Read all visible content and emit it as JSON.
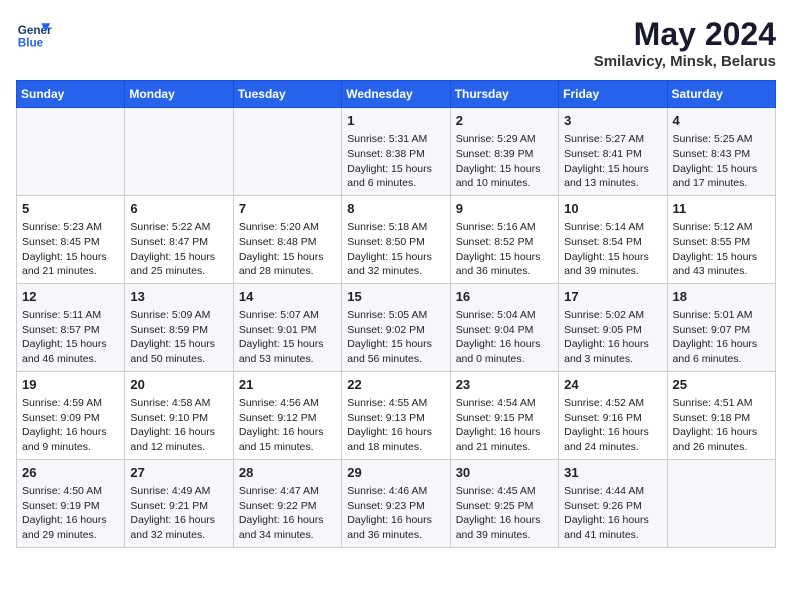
{
  "header": {
    "logo_line1": "General",
    "logo_line2": "Blue",
    "month": "May 2024",
    "location": "Smilavicy, Minsk, Belarus"
  },
  "days_of_week": [
    "Sunday",
    "Monday",
    "Tuesday",
    "Wednesday",
    "Thursday",
    "Friday",
    "Saturday"
  ],
  "weeks": [
    [
      {
        "day": "",
        "info": ""
      },
      {
        "day": "",
        "info": ""
      },
      {
        "day": "",
        "info": ""
      },
      {
        "day": "1",
        "info": "Sunrise: 5:31 AM\nSunset: 8:38 PM\nDaylight: 15 hours\nand 6 minutes."
      },
      {
        "day": "2",
        "info": "Sunrise: 5:29 AM\nSunset: 8:39 PM\nDaylight: 15 hours\nand 10 minutes."
      },
      {
        "day": "3",
        "info": "Sunrise: 5:27 AM\nSunset: 8:41 PM\nDaylight: 15 hours\nand 13 minutes."
      },
      {
        "day": "4",
        "info": "Sunrise: 5:25 AM\nSunset: 8:43 PM\nDaylight: 15 hours\nand 17 minutes."
      }
    ],
    [
      {
        "day": "5",
        "info": "Sunrise: 5:23 AM\nSunset: 8:45 PM\nDaylight: 15 hours\nand 21 minutes."
      },
      {
        "day": "6",
        "info": "Sunrise: 5:22 AM\nSunset: 8:47 PM\nDaylight: 15 hours\nand 25 minutes."
      },
      {
        "day": "7",
        "info": "Sunrise: 5:20 AM\nSunset: 8:48 PM\nDaylight: 15 hours\nand 28 minutes."
      },
      {
        "day": "8",
        "info": "Sunrise: 5:18 AM\nSunset: 8:50 PM\nDaylight: 15 hours\nand 32 minutes."
      },
      {
        "day": "9",
        "info": "Sunrise: 5:16 AM\nSunset: 8:52 PM\nDaylight: 15 hours\nand 36 minutes."
      },
      {
        "day": "10",
        "info": "Sunrise: 5:14 AM\nSunset: 8:54 PM\nDaylight: 15 hours\nand 39 minutes."
      },
      {
        "day": "11",
        "info": "Sunrise: 5:12 AM\nSunset: 8:55 PM\nDaylight: 15 hours\nand 43 minutes."
      }
    ],
    [
      {
        "day": "12",
        "info": "Sunrise: 5:11 AM\nSunset: 8:57 PM\nDaylight: 15 hours\nand 46 minutes."
      },
      {
        "day": "13",
        "info": "Sunrise: 5:09 AM\nSunset: 8:59 PM\nDaylight: 15 hours\nand 50 minutes."
      },
      {
        "day": "14",
        "info": "Sunrise: 5:07 AM\nSunset: 9:01 PM\nDaylight: 15 hours\nand 53 minutes."
      },
      {
        "day": "15",
        "info": "Sunrise: 5:05 AM\nSunset: 9:02 PM\nDaylight: 15 hours\nand 56 minutes."
      },
      {
        "day": "16",
        "info": "Sunrise: 5:04 AM\nSunset: 9:04 PM\nDaylight: 16 hours\nand 0 minutes."
      },
      {
        "day": "17",
        "info": "Sunrise: 5:02 AM\nSunset: 9:05 PM\nDaylight: 16 hours\nand 3 minutes."
      },
      {
        "day": "18",
        "info": "Sunrise: 5:01 AM\nSunset: 9:07 PM\nDaylight: 16 hours\nand 6 minutes."
      }
    ],
    [
      {
        "day": "19",
        "info": "Sunrise: 4:59 AM\nSunset: 9:09 PM\nDaylight: 16 hours\nand 9 minutes."
      },
      {
        "day": "20",
        "info": "Sunrise: 4:58 AM\nSunset: 9:10 PM\nDaylight: 16 hours\nand 12 minutes."
      },
      {
        "day": "21",
        "info": "Sunrise: 4:56 AM\nSunset: 9:12 PM\nDaylight: 16 hours\nand 15 minutes."
      },
      {
        "day": "22",
        "info": "Sunrise: 4:55 AM\nSunset: 9:13 PM\nDaylight: 16 hours\nand 18 minutes."
      },
      {
        "day": "23",
        "info": "Sunrise: 4:54 AM\nSunset: 9:15 PM\nDaylight: 16 hours\nand 21 minutes."
      },
      {
        "day": "24",
        "info": "Sunrise: 4:52 AM\nSunset: 9:16 PM\nDaylight: 16 hours\nand 24 minutes."
      },
      {
        "day": "25",
        "info": "Sunrise: 4:51 AM\nSunset: 9:18 PM\nDaylight: 16 hours\nand 26 minutes."
      }
    ],
    [
      {
        "day": "26",
        "info": "Sunrise: 4:50 AM\nSunset: 9:19 PM\nDaylight: 16 hours\nand 29 minutes."
      },
      {
        "day": "27",
        "info": "Sunrise: 4:49 AM\nSunset: 9:21 PM\nDaylight: 16 hours\nand 32 minutes."
      },
      {
        "day": "28",
        "info": "Sunrise: 4:47 AM\nSunset: 9:22 PM\nDaylight: 16 hours\nand 34 minutes."
      },
      {
        "day": "29",
        "info": "Sunrise: 4:46 AM\nSunset: 9:23 PM\nDaylight: 16 hours\nand 36 minutes."
      },
      {
        "day": "30",
        "info": "Sunrise: 4:45 AM\nSunset: 9:25 PM\nDaylight: 16 hours\nand 39 minutes."
      },
      {
        "day": "31",
        "info": "Sunrise: 4:44 AM\nSunset: 9:26 PM\nDaylight: 16 hours\nand 41 minutes."
      },
      {
        "day": "",
        "info": ""
      }
    ]
  ]
}
